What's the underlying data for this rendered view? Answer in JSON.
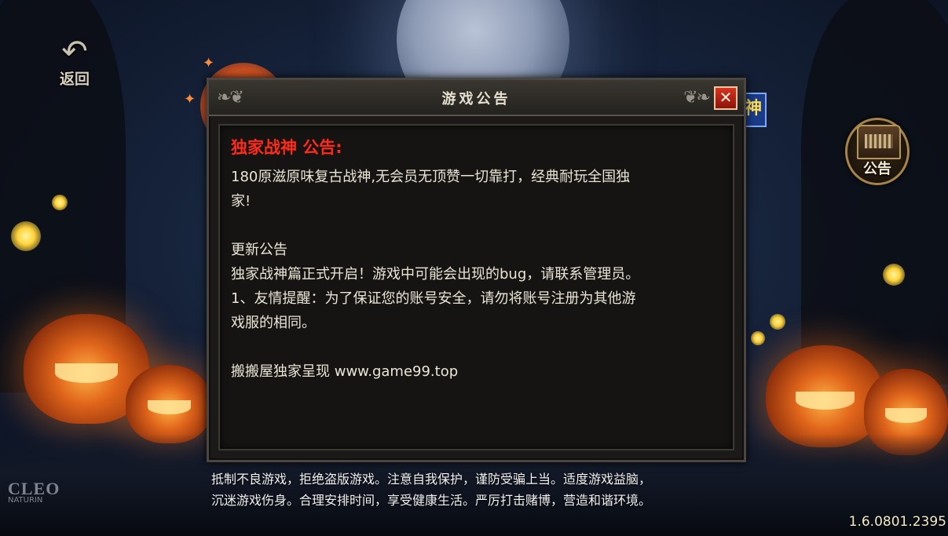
{
  "nav": {
    "back_label": "返回",
    "notice_label": "公告",
    "side_tag": "神"
  },
  "dialog": {
    "title": "游戏公告",
    "close_symbol": "✕",
    "heading": "独家战神 公告:",
    "lines": [
      " 180原滋原味复古战神,无会员无顶赞一切靠打，经典耐玩全国独",
      "家!",
      "",
      " 更新公告",
      " 独家战神篇正式开启！游戏中可能会出现的bug，请联系管理员。",
      "1、友情提醒：为了保证您的账号安全，请勿将账号注册为其他游",
      "戏服的相同。",
      "",
      "搬搬屋独家呈现 www.game99.top"
    ]
  },
  "health_notice": [
    "抵制不良游戏，拒绝盗版游戏。注意自我保护，谨防受骗上当。适度游戏益脑，",
    "沉迷游戏伤身。合理安排时间，享受健康生活。严厉打击赌博，营造和谐环境。"
  ],
  "logo": {
    "main": "CLEO",
    "sub": "NATURIN"
  },
  "version": "1.6.0801.2395",
  "colors": {
    "heading_red": "#ff2a1a",
    "dialog_bg": "#1b1a18",
    "close_red": "#c82a18"
  }
}
